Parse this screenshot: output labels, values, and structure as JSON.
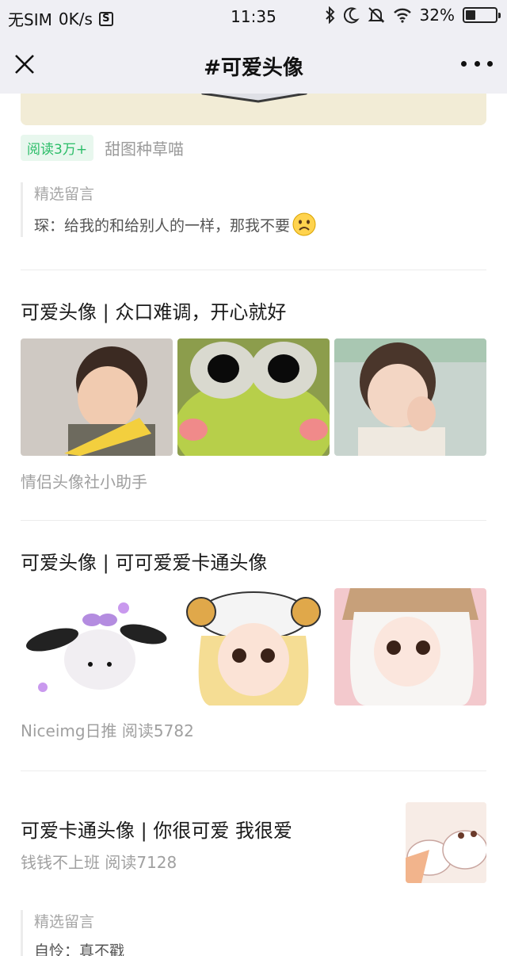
{
  "status_bar": {
    "carrier": "无SIM",
    "speed": "0K/s",
    "s_badge": "S",
    "time": "11:35",
    "battery_percent": "32%",
    "battery_level": 0.32
  },
  "nav": {
    "title": "#可爱头像"
  },
  "first_article": {
    "read_badge": "阅读3万+",
    "source": "甜图种草喵",
    "comment_header": "精选留言",
    "comment_text": "琛：给我的和给别人的一样，那我不要"
  },
  "articles": [
    {
      "title": "可爱头像 | 众口难调，开心就好",
      "meta": "情侣头像社小助手"
    },
    {
      "title": "可爱头像 | 可可爱爱卡通头像",
      "meta": "Niceimg日推  阅读5782"
    },
    {
      "title": "可爱卡通头像 | 你很可爱 我很爱",
      "meta": "钱钱不上班  阅读7128",
      "comment_header": "精选留言",
      "comment_text": "自怜：真不戳"
    }
  ],
  "colors": {
    "accent_green": "#2bbd68",
    "nav_bg": "#efeff4",
    "muted_text": "#a0a0a0"
  }
}
